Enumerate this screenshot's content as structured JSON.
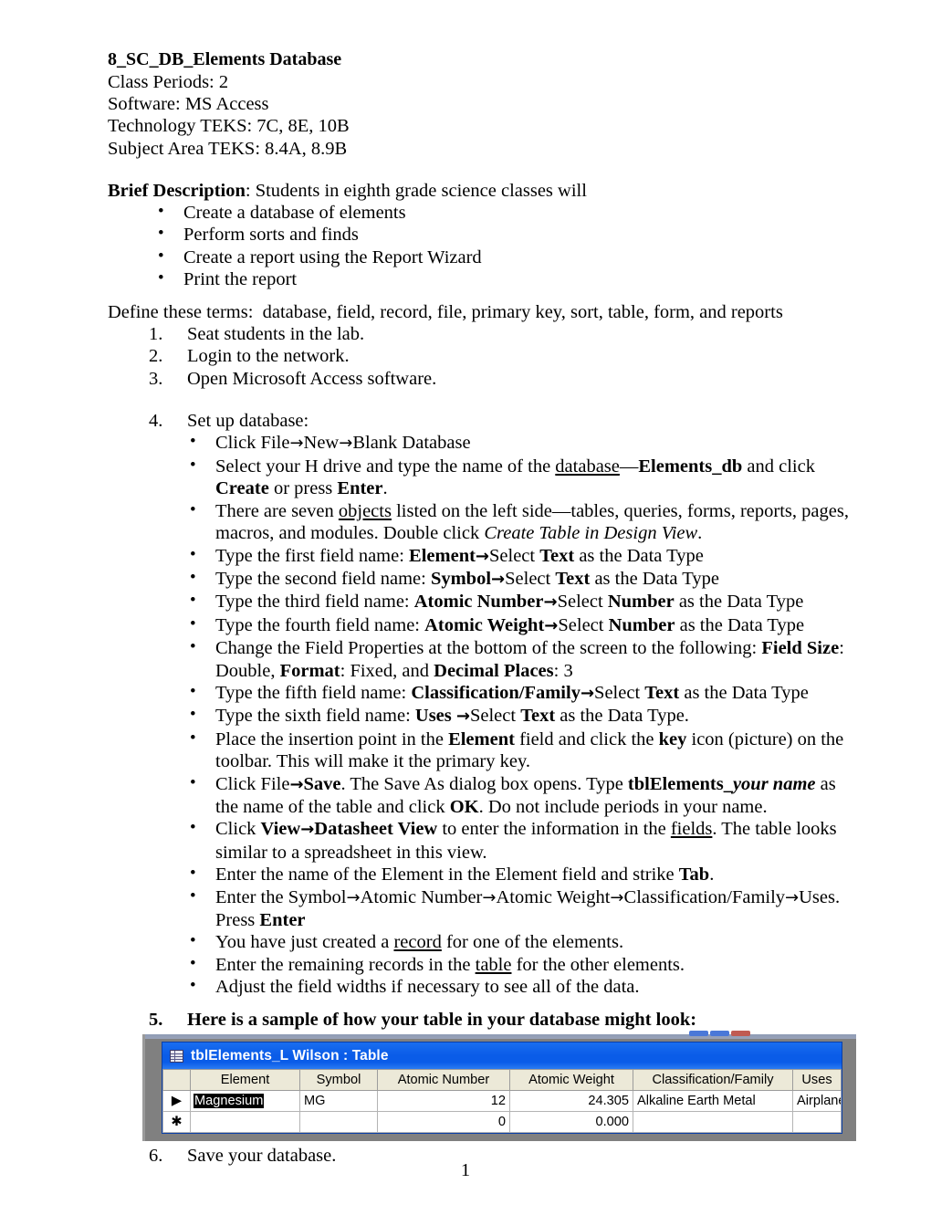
{
  "document": {
    "title": "8_SC_DB_Elements Database",
    "header_lines": [
      "Class Periods: 2",
      "Software: MS Access",
      "Technology TEKS: 7C, 8E, 10B",
      "Subject Area TEKS: 8.4A, 8.9B"
    ],
    "brief_description": {
      "label": "Brief Description",
      "rest": ": Students in eighth grade science classes will",
      "items": [
        "Create a database of elements",
        "Perform sorts and finds",
        "Create a report using the Report Wizard",
        "Print the report"
      ]
    },
    "define_terms": "Define these terms:  database, field, record, file, primary key, sort, table, form, and reports",
    "steps": {
      "s1_num": "1.",
      "s1": "Seat students in the lab.",
      "s2_num": "2.",
      "s2": "Login to the network.",
      "s3_num": "3.",
      "s3": "Open Microsoft Access software.",
      "s4_num": "4.",
      "s4": "Set up database:",
      "s5_num": "5.",
      "s5": "Here is a sample of how your table in your database might look:",
      "s6_num": "6.",
      "s6": "Save your database."
    },
    "setup_bullets": {
      "b1": {
        "t1": "Click File",
        "a1": "→",
        "t2": "New",
        "a2": "→",
        "t3": "Blank Database"
      },
      "b2": {
        "t1": "Select your H drive and type the name of the ",
        "u1": "database",
        "t2": "—",
        "b1": "Elements_db",
        "t3": " and click ",
        "b2": "Create",
        "t4": " or press ",
        "b3": "Enter",
        "t5": "."
      },
      "b3": {
        "t1": "There are seven ",
        "u1": "objects",
        "t2": " listed on the left side—tables, queries, forms, reports, pages, macros, and modules.  Double click ",
        "i1": "Create Table in Design View",
        "t3": "."
      },
      "b4": {
        "t1": "Type the first field name:  ",
        "b1": "Element",
        "a1": "→",
        "t2": "Select ",
        "b2": "Text",
        "t3": " as the Data Type"
      },
      "b5": {
        "t1": "Type the second field name:  ",
        "b1": "Symbol",
        "a1": "→",
        "t2": "Select ",
        "b2": "Text",
        "t3": " as the Data Type"
      },
      "b6": {
        "t1": "Type the third field name:  ",
        "b1": "Atomic Number",
        "a1": "→",
        "t2": "Select ",
        "b2": "Number",
        "t3": " as the Data Type"
      },
      "b7": {
        "t1": "Type the fourth field name:  ",
        "b1": "Atomic Weight",
        "a1": "→",
        "t2": "Select ",
        "b2": "Number",
        "t3": " as the Data Type"
      },
      "b8": {
        "t1": "Change the Field Properties at the bottom of the screen to the following:  ",
        "b1": "Field Size",
        "t2": ": Double, ",
        "b2": "Format",
        "t3": ":  Fixed, and ",
        "b3": "Decimal Places",
        "t4": ":  3"
      },
      "b9": {
        "t1": "Type the fifth field name:  ",
        "b1": "Classification/Family",
        "a1": "→",
        "t2": "Select ",
        "b2": "Text",
        "t3": " as the Data Type"
      },
      "b10": {
        "t1": "Type the sixth field name:  ",
        "b1": "Uses ",
        "a1": "→",
        "t2": "Select ",
        "b2": "Text",
        "t3": " as the Data Type."
      },
      "b11": {
        "t1": "Place the insertion point in the ",
        "b1": "Element",
        "t2": " field and click the ",
        "b2": "key",
        "t3": " icon (picture) on the toolbar.  This will make it the primary key."
      },
      "b12": {
        "t1": "Click File",
        "a1": "→",
        "b1": "Save",
        "t2": ".  The Save As dialog box opens.  Type ",
        "b2": "tblElements_",
        "bi1": "your name",
        "t3": " as the name of the table and click ",
        "b3": "OK",
        "t4": ".  Do not include periods in your name."
      },
      "b13": {
        "t1": "Click ",
        "b1": "View",
        "a1": "→",
        "b2": "Datasheet View",
        "t2": " to enter the information in the ",
        "u1": "fields",
        "t3": ".  The table looks similar to a spreadsheet in this view."
      },
      "b14": {
        "t1": "Enter the name of the Element in the Element field and strike ",
        "b1": "Tab",
        "t2": "."
      },
      "b15": {
        "t1": "Enter the Symbol",
        "a1": "→",
        "t2": "Atomic Number",
        "a2": "→",
        "t3": "Atomic Weight",
        "a3": "→",
        "t4": "Classification/Family",
        "a4": "→",
        "t5": "Uses.  Press ",
        "b1": "Enter"
      },
      "b16": {
        "t1": "You have just created a ",
        "u1": "record",
        "t2": " for one of the elements."
      },
      "b17": {
        "t1": "Enter the remaining records in the ",
        "u1": "table",
        "t2": " for the other elements."
      },
      "b18": {
        "t1": "Adjust the field widths if necessary to see all of the data."
      }
    },
    "page_number": "1"
  },
  "access_screenshot": {
    "window_title": "tblElements_L Wilson : Table",
    "title_icon": "table-icon",
    "title_bar_color": "#0a5ce8",
    "window_controls": [
      "minimize",
      "maximize",
      "close"
    ],
    "columns": [
      "Element",
      "Symbol",
      "Atomic Number",
      "Atomic Weight",
      "Classification/Family",
      "Uses"
    ],
    "rows": [
      {
        "marker": "▶",
        "selected_cell": "Element",
        "Element": "Magnesium",
        "Symbol": "MG",
        "Atomic Number": "12",
        "Atomic Weight": "24.305",
        "Classification/Family": "Alkaline Earth Metal",
        "Uses": "Airplanes, Missiles"
      },
      {
        "marker": "✱",
        "selected_cell": "",
        "Element": "",
        "Symbol": "",
        "Atomic Number": "0",
        "Atomic Weight": "0.000",
        "Classification/Family": "",
        "Uses": ""
      }
    ]
  }
}
